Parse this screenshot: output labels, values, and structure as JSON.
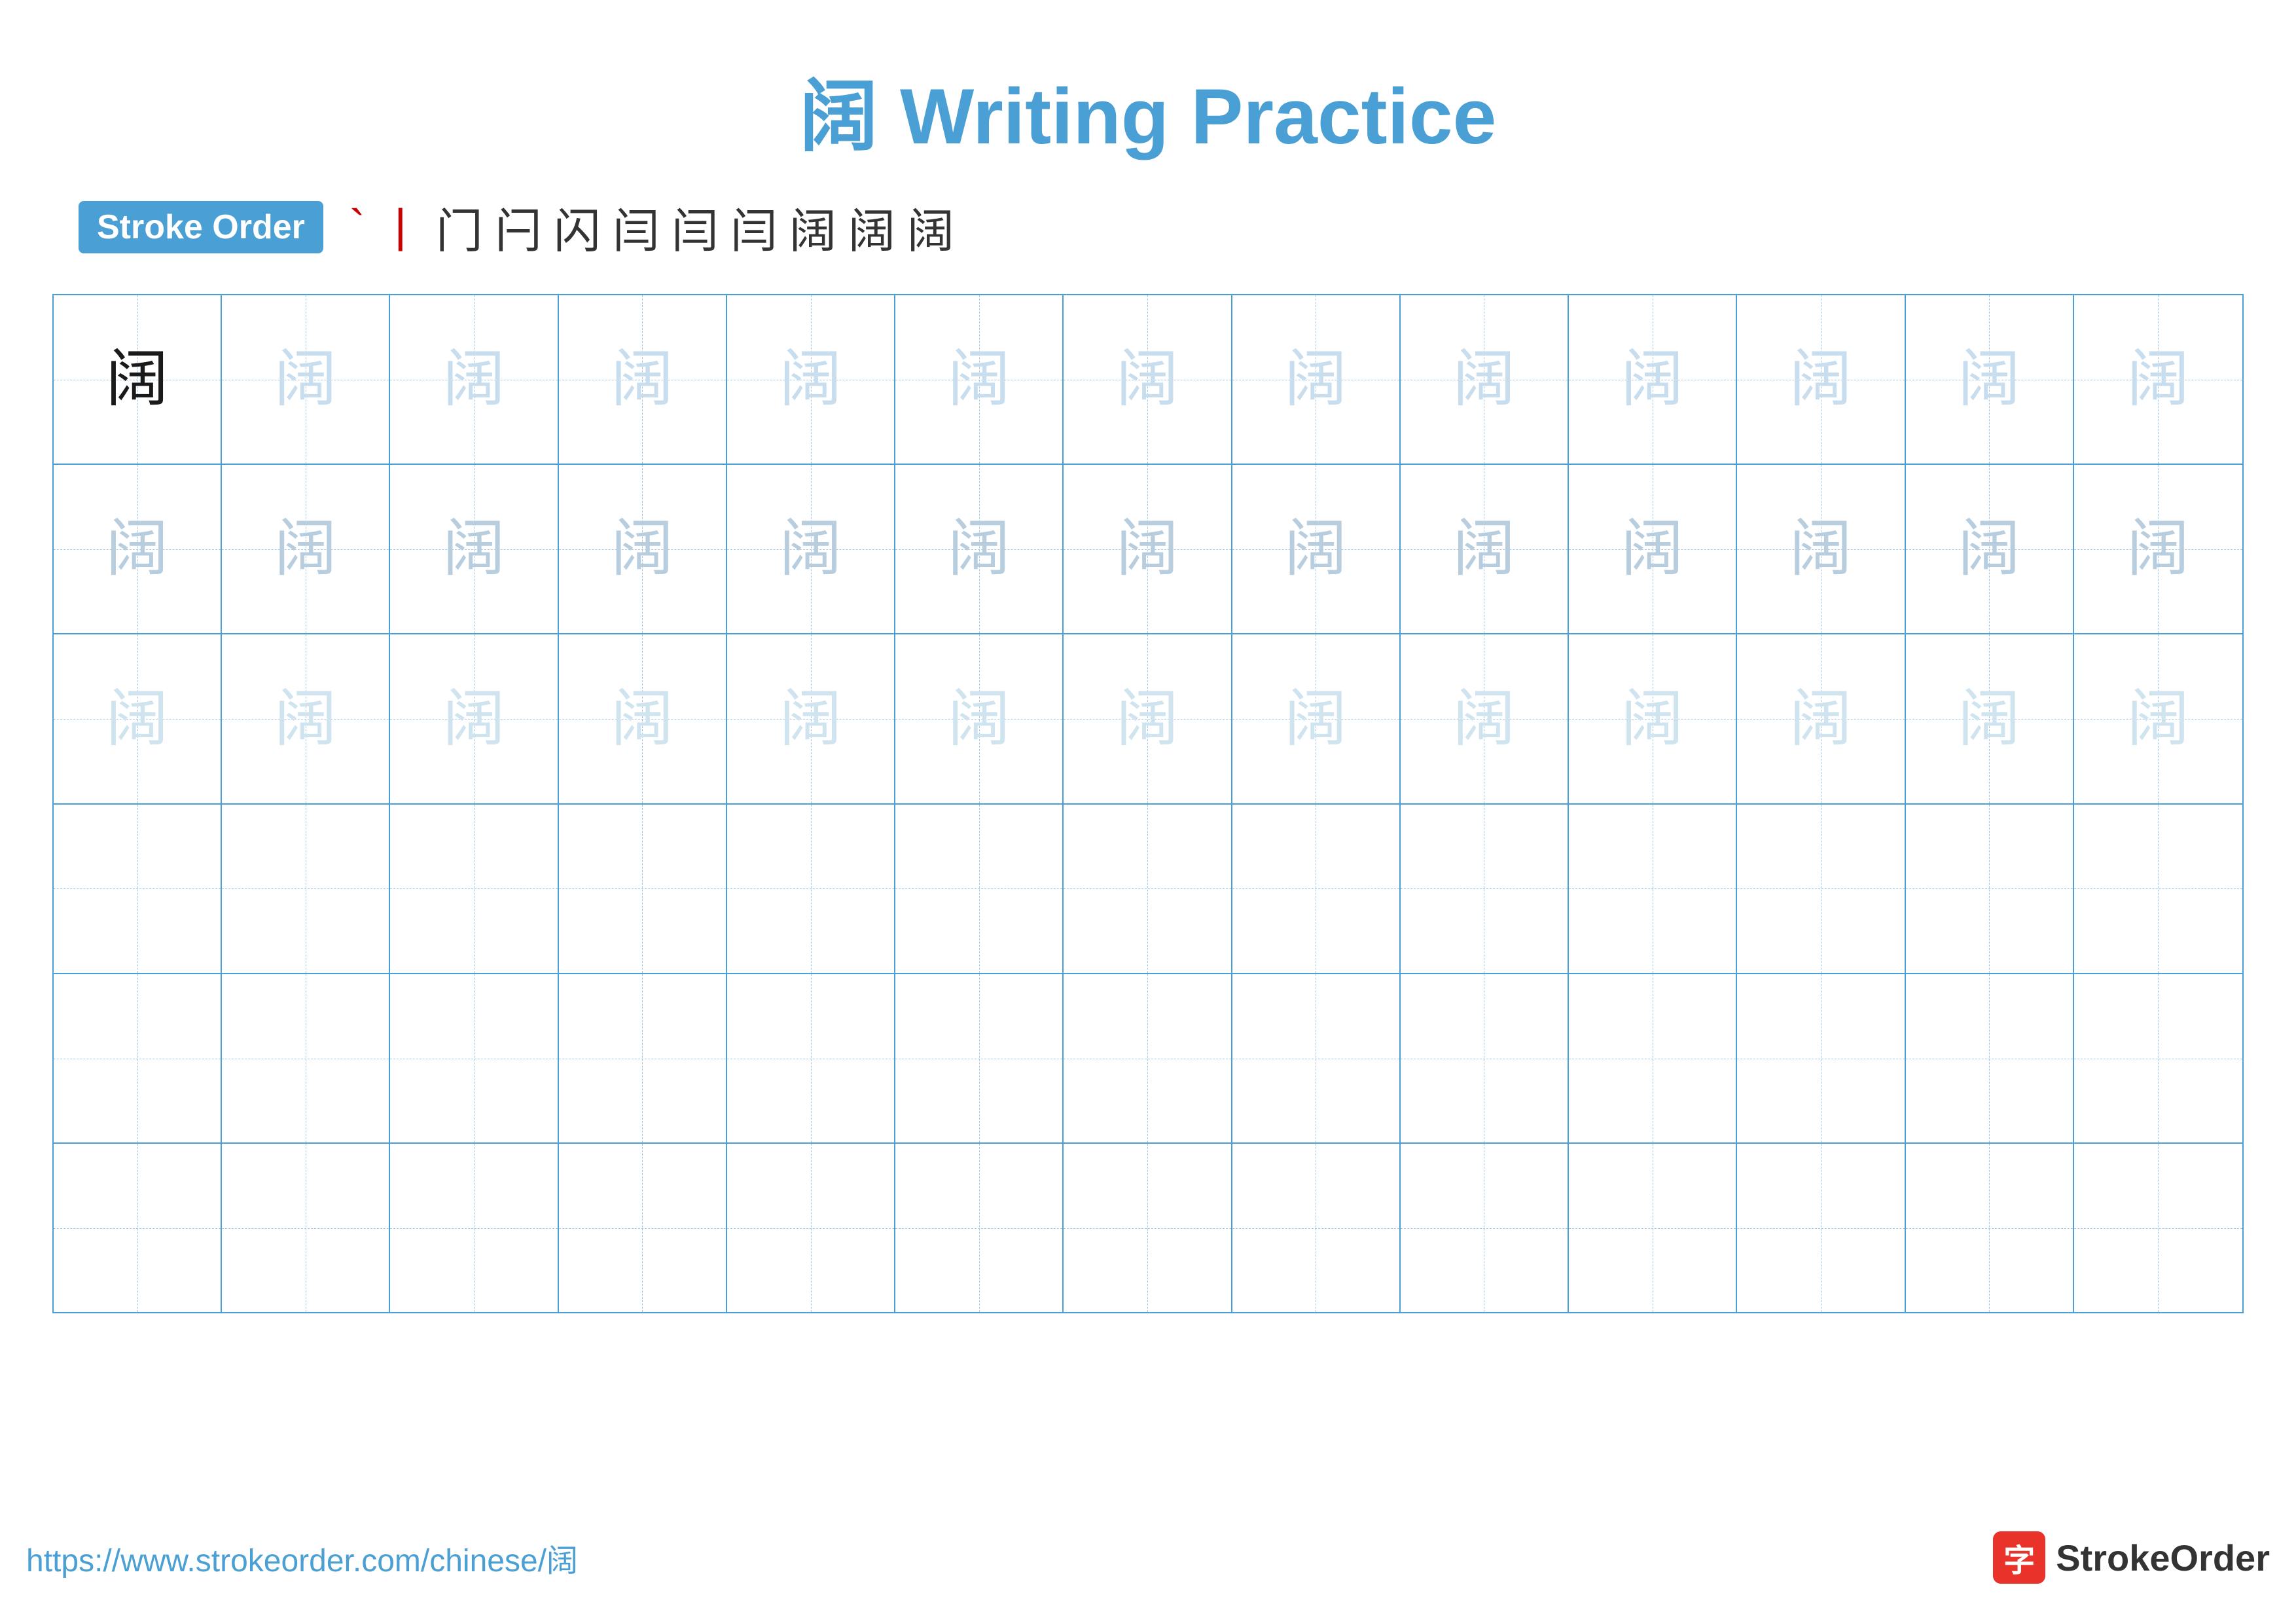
{
  "title": {
    "character": "阔",
    "label": "Writing Practice",
    "full": "阔 Writing Practice"
  },
  "stroke_order": {
    "badge_label": "Stroke Order",
    "strokes": [
      "`",
      "丨",
      "门",
      "闩",
      "闪",
      "闫",
      "闫",
      "闫",
      "阔",
      "阔",
      "阔"
    ]
  },
  "practice_char": "阔",
  "rows": [
    {
      "type": "dark_then_light",
      "dark_count": 1,
      "light_count": 12
    },
    {
      "type": "light_only",
      "count": 13
    },
    {
      "type": "light_only2",
      "count": 13
    },
    {
      "type": "empty"
    },
    {
      "type": "empty"
    },
    {
      "type": "empty"
    }
  ],
  "footer": {
    "url": "https://www.strokeorder.com/chinese/阔",
    "logo_icon": "字",
    "logo_text": "StrokeOrder"
  }
}
